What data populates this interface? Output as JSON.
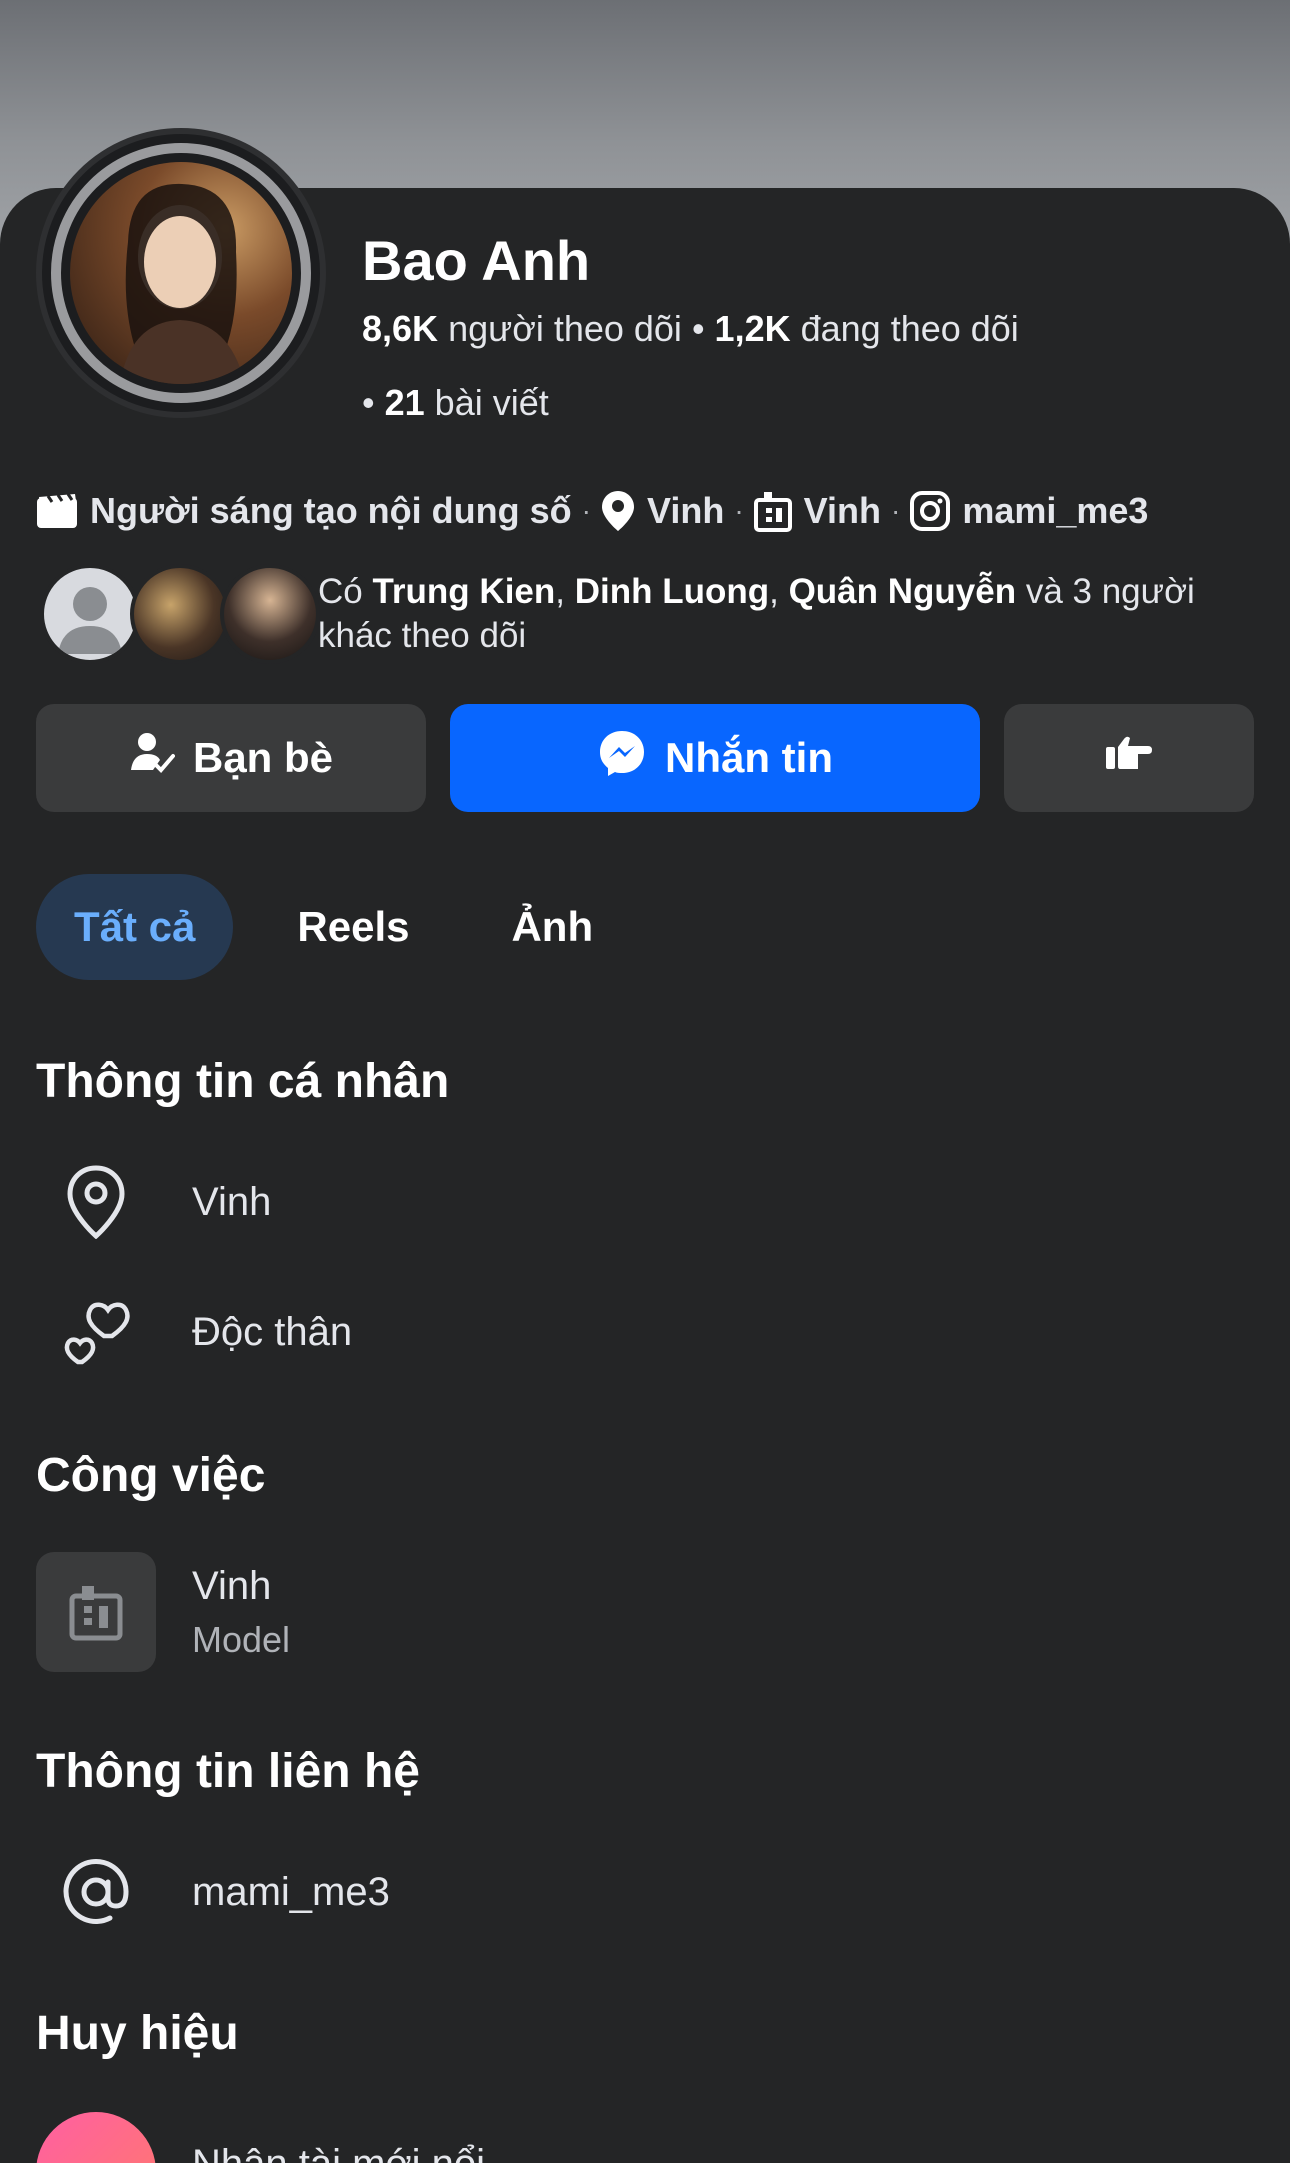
{
  "profile": {
    "name": "Bao Anh",
    "followers_count": "8,6K",
    "followers_label": "người theo dõi",
    "following_count": "1,2K",
    "following_label": "đang theo dõi",
    "posts_count": "21",
    "posts_label": "bài viết"
  },
  "meta": {
    "category": "Người sáng tạo nội dung số",
    "location": "Vinh",
    "workplace": "Vinh",
    "instagram": "mami_me3"
  },
  "mutual": {
    "prefix": "Có",
    "names": [
      "Trung Kien",
      "Dinh Luong",
      "Quân Nguyễn"
    ],
    "suffix": "và 3 người khác theo dõi"
  },
  "actions": {
    "friends_label": "Bạn bè",
    "message_label": "Nhắn tin"
  },
  "tabs": [
    {
      "label": "Tất cả",
      "active": true
    },
    {
      "label": "Reels",
      "active": false
    },
    {
      "label": "Ảnh",
      "active": false
    }
  ],
  "personal": {
    "title": "Thông tin cá nhân",
    "location": "Vinh",
    "relationship": "Độc thân"
  },
  "work": {
    "title": "Công việc",
    "company": "Vinh",
    "position": "Model"
  },
  "contact": {
    "title": "Thông tin liên hệ",
    "handle": "mami_me3"
  },
  "badges": {
    "title": "Huy hiệu",
    "first_label": "Nhân tài mới nổi"
  },
  "colors": {
    "background": "#242526",
    "accent": "#0866ff",
    "active_tab_bg": "#263951",
    "active_tab_text": "#6aaefc",
    "button_gray": "#3a3b3c"
  },
  "icons": {
    "category": "clapperboard-icon",
    "location": "map-pin-icon",
    "workplace": "building-icon",
    "instagram": "instagram-icon",
    "friends": "person-check-icon",
    "messenger": "messenger-icon",
    "more": "pointing-hand-icon",
    "relationship": "hearts-icon",
    "contact": "at-sign-icon"
  }
}
